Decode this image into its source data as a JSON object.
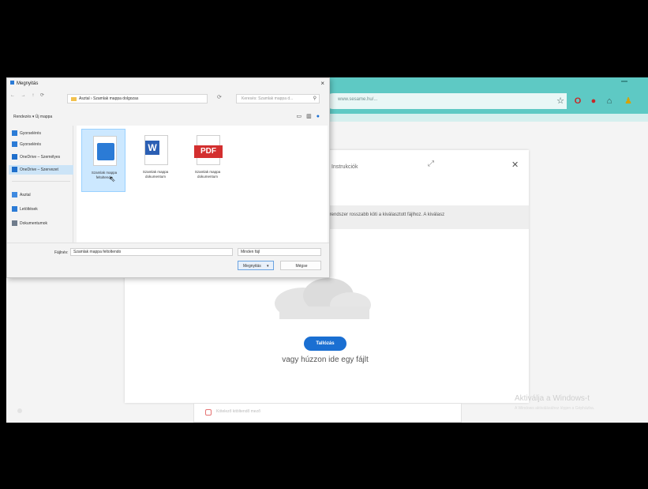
{
  "browser": {
    "address_text": "www.sesame.hu/...",
    "icons": [
      "star-icon",
      "opera-icon",
      "stop-icon",
      "extension-icon",
      "profile-icon"
    ]
  },
  "dialog": {
    "title": "Megnyitás",
    "close": "×",
    "nav": "← → ↑ ⟳",
    "address": "Asztal › Szamlak mappa dolgozas",
    "refresh": "⟳",
    "search_placeholder": "Keresés: Szamlak mappa d...",
    "cmd_bar": "Rendezés ▾     Új mappa",
    "view_icons": [
      "view-icon",
      "layout-icon",
      "help-icon"
    ],
    "nav_items": [
      {
        "label": "Gyorselérés",
        "color": "#2b7bd6"
      },
      {
        "label": "Gyorselérés",
        "color": "#2b7bd6"
      },
      {
        "label": "OneDrive – Személyes",
        "color": "#1f6fcc"
      },
      {
        "label": "OneDrive – Szervezet",
        "color": "#1f6fcc",
        "selected": true
      },
      {
        "label": "Asztal",
        "color": "#3f8ae0"
      },
      {
        "label": "Letöltések",
        "color": "#2b7bd6"
      },
      {
        "label": "Dokumentumok",
        "color": "#6f7c8c"
      }
    ],
    "files": [
      {
        "name": "Szamlak mappa feltoltendo",
        "kind": "image",
        "selected": true
      },
      {
        "name": "Szamlak mappa dokumentum",
        "kind": "word"
      },
      {
        "name": "Szamlak mappa dokumentum",
        "kind": "pdf",
        "badge": "PDF"
      }
    ],
    "filename_label": "Fájlnév:",
    "filename_value": "Szamlak mappa feltoltendo",
    "filetype_value": "Minden fájl",
    "open_label": "Megnyitás",
    "open_arrow": "▾",
    "cancel_label": "Mégse"
  },
  "page": {
    "card_title": "Instrukciók",
    "card_expand": "⤢",
    "card_close": "✕",
    "info_text": "... A rendszer rosszabb köti a kiválasztott fájlhoz. A kiválasz",
    "upload_label": "Tallózás",
    "drop_text": "vagy húzzon ide egy fájlt",
    "watermark": "Aktiválja a Windows-t",
    "watermark_sub": "A Windows aktiválásához lépjen a Gépházba.",
    "bottom_field": "Kötelező kitöltendő mező"
  }
}
